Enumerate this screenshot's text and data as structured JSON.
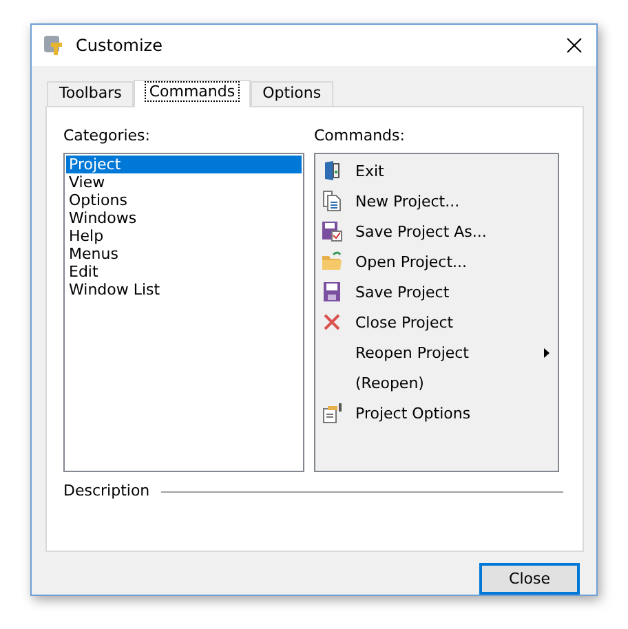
{
  "window": {
    "title": "Customize"
  },
  "tabs": [
    {
      "label": "Toolbars",
      "selected": false
    },
    {
      "label": "Commands",
      "selected": true
    },
    {
      "label": "Options",
      "selected": false
    }
  ],
  "categories": {
    "label": "Categories:",
    "items": [
      {
        "label": "Project",
        "selected": true
      },
      {
        "label": "View",
        "selected": false
      },
      {
        "label": "Options",
        "selected": false
      },
      {
        "label": "Windows",
        "selected": false
      },
      {
        "label": "Help",
        "selected": false
      },
      {
        "label": "Menus",
        "selected": false
      },
      {
        "label": "Edit",
        "selected": false
      },
      {
        "label": "Window List",
        "selected": false
      }
    ]
  },
  "commands": {
    "label": "Commands:",
    "items": [
      {
        "label": "Exit",
        "kind": "exit",
        "submenu": false
      },
      {
        "label": "New Project...",
        "kind": "new",
        "submenu": false
      },
      {
        "label": "Save Project As...",
        "kind": "saveas",
        "submenu": false
      },
      {
        "label": "Open Project...",
        "kind": "open",
        "submenu": false
      },
      {
        "label": "Save Project",
        "kind": "save",
        "submenu": false
      },
      {
        "label": "Close Project",
        "kind": "close",
        "submenu": false
      },
      {
        "label": "Reopen Project",
        "kind": "plain",
        "submenu": true
      },
      {
        "label": "(Reopen)",
        "kind": "plain",
        "submenu": false
      },
      {
        "label": "Project Options",
        "kind": "options",
        "submenu": false
      }
    ]
  },
  "description": {
    "label": "Description"
  },
  "buttons": [
    {
      "label": "Close"
    }
  ]
}
